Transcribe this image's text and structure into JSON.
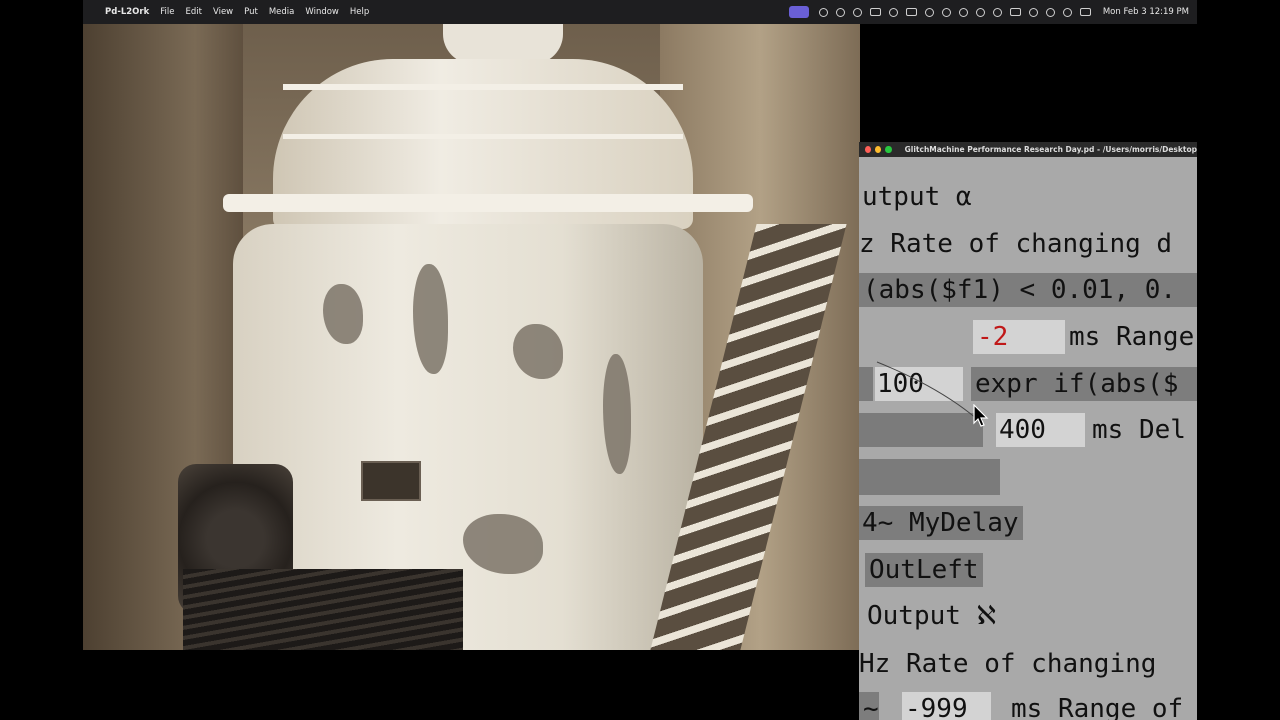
{
  "menubar": {
    "apple": "",
    "app_name": "Pd-L2Ork",
    "menus": [
      "File",
      "Edit",
      "View",
      "Put",
      "Media",
      "Window",
      "Help"
    ],
    "clock": "Mon Feb 3  12:19 PM"
  },
  "pd_window": {
    "title": "GlitchMachine Performance Research Day.pd  - /Users/morris/Desktop",
    "canvas": {
      "output_alpha": "utput α",
      "rate_label_1": "z Rate of changing d",
      "expr_1": "(abs($f1) < 0.01, 0.",
      "number_minus2": "-2",
      "ms_range": "ms Range",
      "number_100": "100",
      "expr_2": "expr if(abs($",
      "number_400": "400",
      "ms_delay": "ms Del",
      "mydelay": "4~ MyDelay",
      "outleft": "OutLeft",
      "output_aleph": "Output ℵ",
      "rate_label_2": "Hz Rate of changing",
      "tilde": "~",
      "number_minus999": "-999",
      "ms_range_of": "ms Range of"
    }
  }
}
